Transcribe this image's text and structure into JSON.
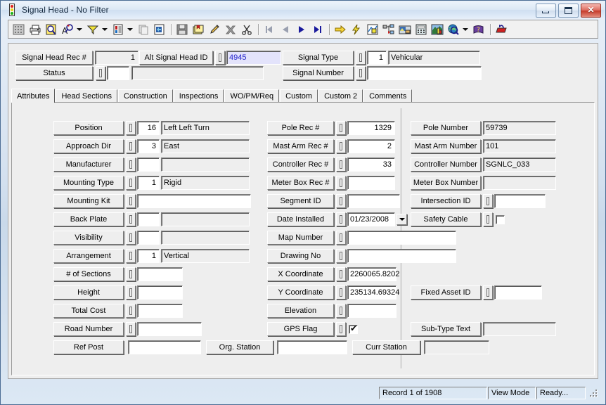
{
  "window": {
    "title": "Signal Head - No Filter",
    "icon": "traffic-signal-icon",
    "minimize_label": "",
    "maximize_label": "",
    "close_label": "✕"
  },
  "toolbar": {
    "items": [
      {
        "name": "grid-view-icon",
        "label": ""
      },
      {
        "name": "print-icon",
        "label": ""
      },
      {
        "name": "print-preview-icon",
        "label": ""
      },
      {
        "name": "find-icon",
        "label": ""
      },
      {
        "name": "find-dropdown-arrow",
        "label": ""
      },
      {
        "name": "filter-icon",
        "label": ""
      },
      {
        "name": "filter-dropdown-arrow",
        "label": ""
      },
      {
        "name": "report-icon",
        "label": ""
      },
      {
        "name": "report-dropdown-arrow",
        "label": ""
      },
      {
        "name": "copy-record-icon",
        "label": ""
      },
      {
        "name": "export-icon",
        "label": ""
      },
      {
        "name": "save-icon",
        "label": ""
      },
      {
        "name": "add-record-icon",
        "label": ""
      },
      {
        "name": "edit-record-icon",
        "label": ""
      },
      {
        "name": "delete-record-icon",
        "label": ""
      },
      {
        "name": "cut-icon",
        "label": ""
      },
      {
        "name": "first-record-icon",
        "label": ""
      },
      {
        "name": "previous-record-icon",
        "label": ""
      },
      {
        "name": "next-record-icon",
        "label": ""
      },
      {
        "name": "last-record-icon",
        "label": ""
      },
      {
        "name": "goto-icon",
        "label": ""
      },
      {
        "name": "lightning-icon",
        "label": ""
      },
      {
        "name": "map-layers-icon",
        "label": ""
      },
      {
        "name": "hierarchy-icon",
        "label": ""
      },
      {
        "name": "image-icon",
        "label": ""
      },
      {
        "name": "calculator-icon",
        "label": ""
      },
      {
        "name": "chart-icon",
        "label": ""
      },
      {
        "name": "globe-icon",
        "label": ""
      },
      {
        "name": "globe-dropdown-arrow",
        "label": ""
      },
      {
        "name": "help-book-icon",
        "label": ""
      },
      {
        "name": "exit-icon",
        "label": ""
      }
    ]
  },
  "header": {
    "signal_head_rec": {
      "label": "Signal Head Rec #",
      "value": "1"
    },
    "alt_signal_head_id": {
      "label": "Alt Signal Head  ID",
      "value": "4945"
    },
    "status": {
      "label": "Status",
      "code": "",
      "text": ""
    },
    "signal_type": {
      "label": "Signal Type",
      "code": "1",
      "text": "Vehicular"
    },
    "signal_number": {
      "label": "Signal Number",
      "value": ""
    }
  },
  "tabs": [
    {
      "label": "Attributes",
      "active": true
    },
    {
      "label": "Head Sections",
      "active": false
    },
    {
      "label": "Construction",
      "active": false
    },
    {
      "label": "Inspections",
      "active": false
    },
    {
      "label": "WO/PM/Req",
      "active": false
    },
    {
      "label": "Custom",
      "active": false
    },
    {
      "label": "Custom 2",
      "active": false
    },
    {
      "label": "Comments",
      "active": false
    }
  ],
  "left_column": [
    {
      "label": "Position",
      "code": "16",
      "text": "Left Left Turn"
    },
    {
      "label": "Approach Dir",
      "code": "3",
      "text": "East"
    },
    {
      "label": "Manufacturer",
      "code": "",
      "text": ""
    },
    {
      "label": "Mounting Type",
      "code": "1",
      "text": "Rigid"
    },
    {
      "label": "Mounting Kit",
      "code": null,
      "text": ""
    },
    {
      "label": "Back Plate",
      "code": "",
      "text": ""
    },
    {
      "label": "Visibility",
      "code": "",
      "text": ""
    },
    {
      "label": "Arrangement",
      "code": "1",
      "text": "Vertical"
    },
    {
      "label": "# of Sections",
      "code": null,
      "text": ""
    },
    {
      "label": "Height",
      "code": null,
      "text": ""
    },
    {
      "label": "Total Cost",
      "code": null,
      "text": ""
    },
    {
      "label": "Road Number",
      "code": null,
      "text": ""
    }
  ],
  "mid_column": [
    {
      "label": "Pole Rec #",
      "value": "1329"
    },
    {
      "label": "Mast Arm Rec #",
      "value": "2"
    },
    {
      "label": "Controller Rec #",
      "value": "33"
    },
    {
      "label": "Meter Box Rec #",
      "value": ""
    },
    {
      "label": "Segment ID",
      "value": ""
    },
    {
      "label": "Date Installed",
      "value": "01/23/2008"
    },
    {
      "label": "Map Number",
      "value": ""
    },
    {
      "label": "Drawing No",
      "value": ""
    },
    {
      "label": "X Coordinate",
      "value": "2260065.8202"
    },
    {
      "label": "Y Coordinate",
      "value": "235134.69324"
    },
    {
      "label": "Elevation",
      "value": ""
    },
    {
      "label": "GPS Flag",
      "value": "",
      "checked": true
    }
  ],
  "right_column": [
    {
      "label": "Pole Number",
      "value": "59739"
    },
    {
      "label": "Mast Arm Number",
      "value": "101"
    },
    {
      "label": "Controller Number",
      "value": "SGNLC_033"
    },
    {
      "label": "Meter Box Number",
      "value": ""
    },
    {
      "label": "Intersection ID",
      "value": ""
    },
    {
      "label": "Safety Cable",
      "value": "",
      "checked": false
    },
    {
      "label": "Fixed Asset ID",
      "value": ""
    },
    {
      "label": "Sub-Type Text",
      "value": ""
    }
  ],
  "bottom_row": {
    "ref_post": {
      "label": "Ref Post",
      "value": ""
    },
    "org_station": {
      "label": "Org. Station",
      "value": ""
    },
    "curr_station": {
      "label": "Curr Station",
      "value": ""
    }
  },
  "statusbar": {
    "record": "Record 1 of 1908",
    "mode": "View Mode",
    "state": "Ready..."
  },
  "colors": {
    "window_border": "#4b6c94",
    "panel_face": "#eeeeee",
    "field_text": "#000000",
    "highlight_text": "#2222cc",
    "highlight_bg": "#e3e3fb"
  }
}
